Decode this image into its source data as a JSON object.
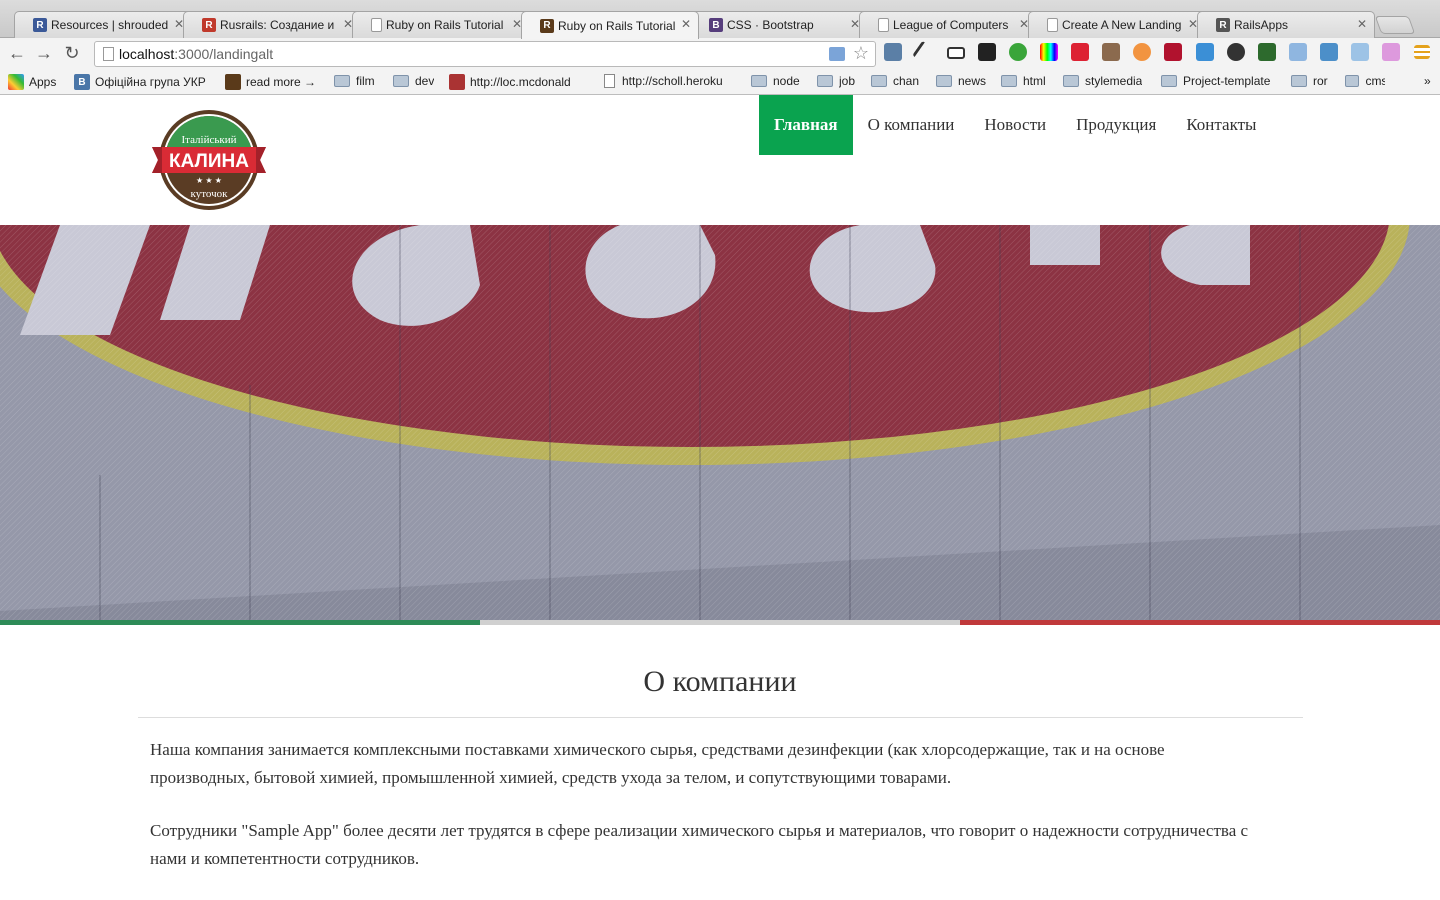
{
  "browser": {
    "tabs": [
      {
        "title": "Resources | shrouded",
        "color": "#3b5998",
        "letter": "R"
      },
      {
        "title": "Rusrails: Создание и",
        "color": "#c0392b",
        "letter": "R"
      },
      {
        "title": "Ruby on Rails Tutorial",
        "color": "",
        "letter": ""
      },
      {
        "title": "Ruby on Rails Tutorial",
        "color": "#5a3a1a",
        "letter": "R"
      },
      {
        "title": "CSS · Bootstrap",
        "color": "#563d7c",
        "letter": "B"
      },
      {
        "title": "League of Computers",
        "color": "",
        "letter": ""
      },
      {
        "title": "Create A New Landing",
        "color": "",
        "letter": ""
      },
      {
        "title": "RailsApps",
        "color": "#555",
        "letter": "R"
      }
    ],
    "url_host": "localhost",
    "url_path": ":3000/landingalt",
    "bookmarks": [
      {
        "label": "Apps",
        "type": "apps"
      },
      {
        "label": "Офіційна група УКР",
        "type": "vk"
      },
      {
        "label": "read more →",
        "type": "icon"
      },
      {
        "label": "film",
        "type": "folder"
      },
      {
        "label": "dev",
        "type": "folder"
      },
      {
        "label": "http://loc.mcdonald",
        "type": "icon2"
      },
      {
        "label": "http://scholl.heroku",
        "type": "doc"
      },
      {
        "label": "node",
        "type": "folder"
      },
      {
        "label": "job",
        "type": "folder"
      },
      {
        "label": "chan",
        "type": "folder"
      },
      {
        "label": "news",
        "type": "folder"
      },
      {
        "label": "html",
        "type": "folder"
      },
      {
        "label": "stylemedia",
        "type": "folder"
      },
      {
        "label": "Project-template",
        "type": "folder"
      },
      {
        "label": "ror",
        "type": "folder"
      },
      {
        "label": "cms",
        "type": "folder"
      }
    ],
    "more": "»"
  },
  "site": {
    "logo": {
      "top": "Італійський",
      "main": "КАЛИНА",
      "bottom": "куточок"
    },
    "nav": [
      "Главная",
      "О компании",
      "Новости",
      "Продукция",
      "Контакты"
    ],
    "active_nav": 0,
    "flag_colors": [
      "#2e8b57",
      "#d0d0d0",
      "#c0393b"
    ],
    "about": {
      "title": "О компании",
      "p1": "Наша компания занимается комплексными поставками химического сырья, средствами дезинфекции (как хлорсодержащие, так и на основе производных, бытовой химией, промышленной химией, средств ухода за телом, и сопутствующими товарами.",
      "p2": "Сотрудники \"Sample App\" более десяти лет трудятся в сфере реализации химического сырья и материалов, что говорит о надежности сотрудничества с нами и компетентности сотрудников."
    },
    "colors": {
      "accent": "#0aa34f",
      "hero_red": "#8b2f3c",
      "hero_ring": "#b7b35a"
    }
  }
}
